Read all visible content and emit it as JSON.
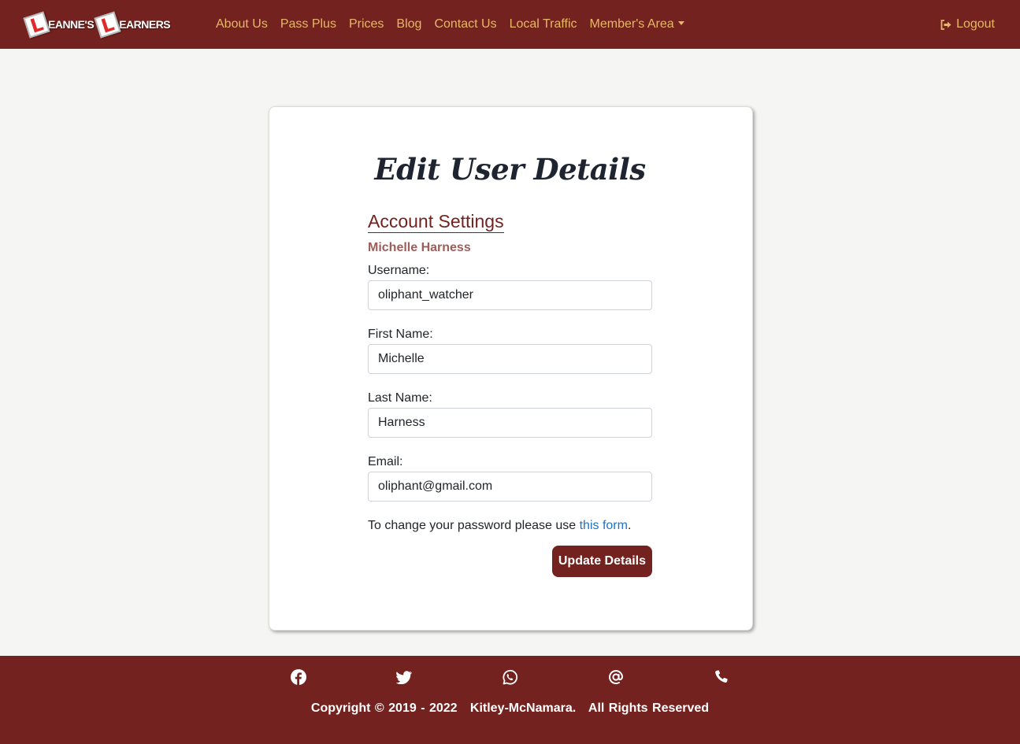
{
  "brand": {
    "word1": "EANNE'S",
    "word2": "EARNERS",
    "plate_letter": "L"
  },
  "nav": {
    "items": [
      {
        "label": "About Us"
      },
      {
        "label": "Pass Plus"
      },
      {
        "label": "Prices"
      },
      {
        "label": "Blog"
      },
      {
        "label": "Contact Us"
      },
      {
        "label": "Local Traffic"
      },
      {
        "label": "Member's Area"
      }
    ],
    "logout_label": "Logout"
  },
  "page": {
    "title": "Edit User Details",
    "section_title": "Account Settings",
    "user_full_name": "Michelle Harness",
    "fields": {
      "username": {
        "label": "Username:",
        "value": "oliphant_watcher"
      },
      "first_name": {
        "label": "First Name:",
        "value": "Michelle"
      },
      "last_name": {
        "label": "Last Name:",
        "value": "Harness"
      },
      "email": {
        "label": "Email:",
        "value": "oliphant@gmail.com"
      }
    },
    "password_note": {
      "prefix": "To change your password please use ",
      "link": "this form",
      "suffix": "."
    },
    "submit_label": "Update Details"
  },
  "footer": {
    "social_icons": [
      "facebook-icon",
      "twitter-icon",
      "whatsapp-icon",
      "email-at-icon",
      "phone-icon"
    ],
    "copyright": "Copyright © 2019 - 2022   Kitley-McNamara.   All Rights Reserved"
  },
  "colors": {
    "brand": "#74221f",
    "nav_link": "#e7b768",
    "link": "#1a73c8"
  }
}
